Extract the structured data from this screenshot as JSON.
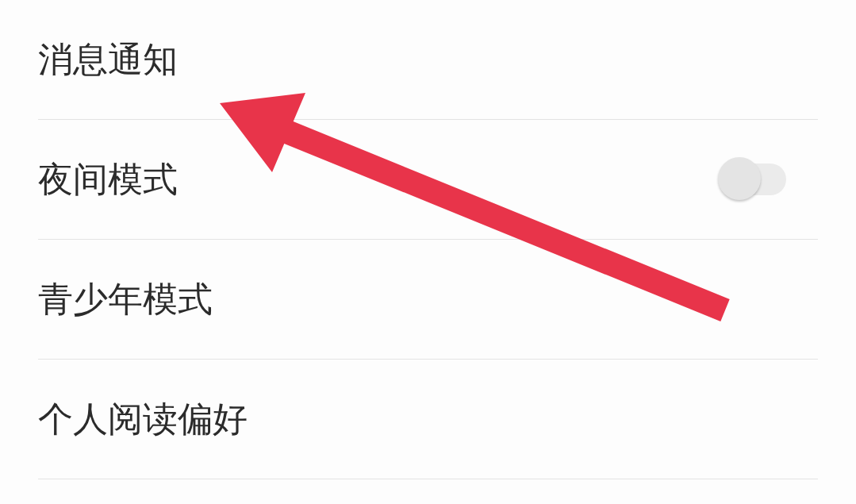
{
  "settings": [
    {
      "label": "消息通知",
      "kind": "plain"
    },
    {
      "label": "夜间模式",
      "kind": "toggle",
      "on": false
    },
    {
      "label": "青少年模式",
      "kind": "plain"
    },
    {
      "label": "个人阅读偏好",
      "kind": "plain"
    }
  ],
  "annotations": [
    {
      "kind": "arrow"
    }
  ]
}
